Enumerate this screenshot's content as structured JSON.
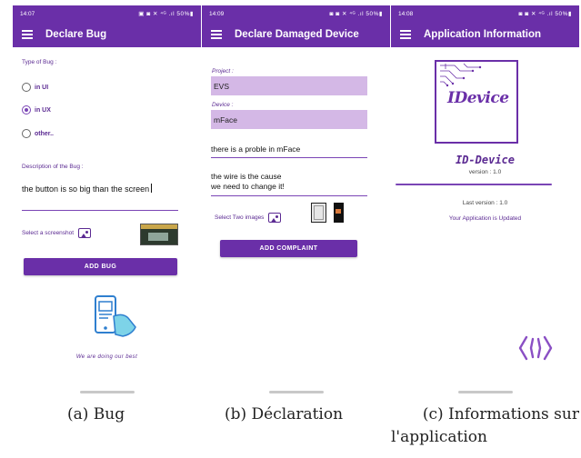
{
  "screens": {
    "bug": {
      "status_time": "14:07",
      "status_icons": "▣ ◙ ✕ ⁴ᴳ .ıl 50%▮",
      "title": "Declare Bug",
      "type_label": "Type of Bug :",
      "options": [
        {
          "label": "in UI",
          "selected": false
        },
        {
          "label": "in UX",
          "selected": true
        },
        {
          "label": "other..",
          "selected": false
        }
      ],
      "description_label": "Description of the Bug :",
      "description_value": "the button is so big than the screen",
      "screenshot_label": "Select a screenshot",
      "button": "ADD BUG",
      "tagline": "We are doing our best"
    },
    "declaration": {
      "status_time": "14:09",
      "status_icons": "◙ ◙ ✕ ⁴ᴳ .ıl 50%▮",
      "title": "Declare Damaged Device",
      "project_label": "Project :",
      "project_value": "EVS",
      "device_label": "Device :",
      "device_value": "mFace",
      "problem_value": "there is a proble in mFace",
      "cause_line1": "the wire is the cause",
      "cause_line2": "we need to change it!",
      "images_label": "Select Two images",
      "button": "ADD COMPLAINT"
    },
    "info": {
      "status_time": "14:08",
      "status_icons": "◙ ◙ ✕ ⁴ᴳ .ıl 50%▮",
      "title": "Application Information",
      "logo_text": "IDevice",
      "app_name": "ID-Device",
      "version": "version : 1.0",
      "last_version": "Last version : 1.0",
      "update_status": "Your Application is Updated"
    }
  },
  "captions": {
    "a": "(a) Bug",
    "b": "(b) Déclaration",
    "c_line1": "(c) Informations sur",
    "c_line2": "l'application"
  },
  "colors": {
    "primary": "#6a2fa8",
    "accent": "#7a45b5",
    "field_fill": "#d4b8e6"
  }
}
